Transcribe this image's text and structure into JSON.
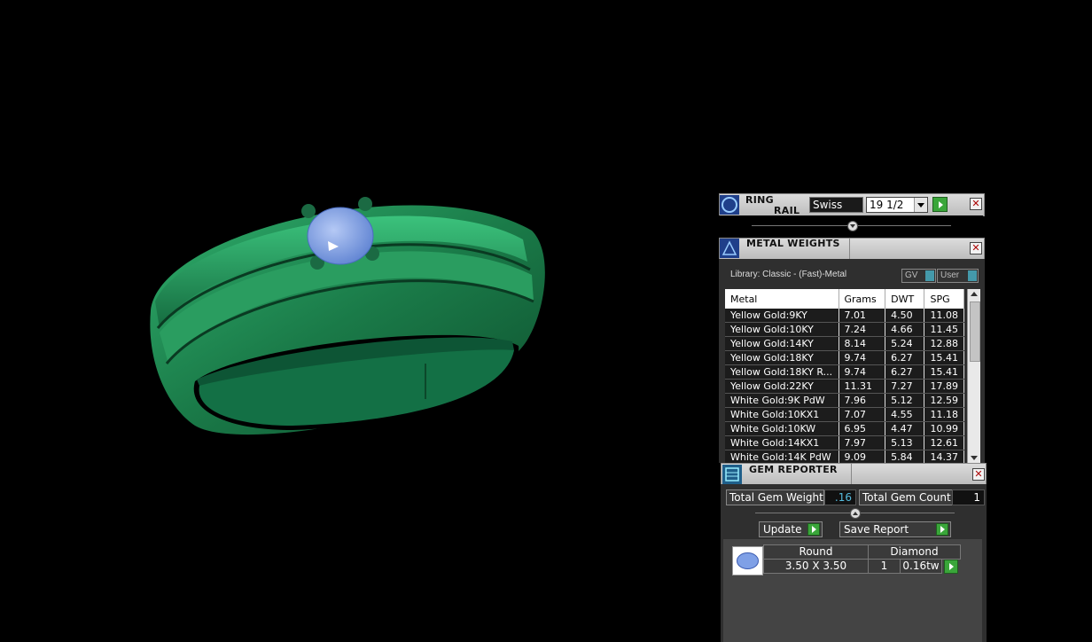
{
  "ring_rail": {
    "title_line1": "RING",
    "title_line2": "RAIL",
    "standard": "Swiss",
    "size": "19 1/2"
  },
  "metal_weights": {
    "title": "METAL WEIGHTS",
    "library": "Library: Classic - (Fast)-Metal",
    "toggle_gv": "GV",
    "toggle_user": "User",
    "columns": [
      "Metal",
      "Grams",
      "DWT",
      "SPG"
    ],
    "rows": [
      [
        "Yellow Gold:9KY",
        "7.01",
        "4.50",
        "11.08"
      ],
      [
        "Yellow Gold:10KY",
        "7.24",
        "4.66",
        "11.45"
      ],
      [
        "Yellow Gold:14KY",
        "8.14",
        "5.24",
        "12.88"
      ],
      [
        "Yellow Gold:18KY",
        "9.74",
        "6.27",
        "15.41"
      ],
      [
        "Yellow Gold:18KY R...",
        "9.74",
        "6.27",
        "15.41"
      ],
      [
        "Yellow Gold:22KY",
        "11.31",
        "7.27",
        "17.89"
      ],
      [
        "White Gold:9K PdW",
        "7.96",
        "5.12",
        "12.59"
      ],
      [
        "White Gold:10KX1",
        "7.07",
        "4.55",
        "11.18"
      ],
      [
        "White Gold:10KW",
        "6.95",
        "4.47",
        "10.99"
      ],
      [
        "White Gold:14KX1",
        "7.97",
        "5.13",
        "12.61"
      ],
      [
        "White Gold:14K PdW",
        "9.09",
        "5.84",
        "14.37"
      ]
    ]
  },
  "gem_reporter": {
    "title": "GEM REPORTER",
    "total_weight_label": "Total Gem Weight",
    "total_weight_value": ".16",
    "total_count_label": "Total Gem Count",
    "total_count_value": "1",
    "update_label": "Update",
    "save_label": "Save Report",
    "gems": [
      {
        "shape": "Round",
        "material": "Diamond",
        "size": "3.50 X 3.50",
        "count": "1",
        "weight": "0.16tw"
      }
    ]
  },
  "colors": {
    "ring_green": "#1f8a55",
    "gem_blue": "#7fa0e6",
    "panel_bg": "#2f2f2f",
    "accent_green": "#3aa63a"
  }
}
